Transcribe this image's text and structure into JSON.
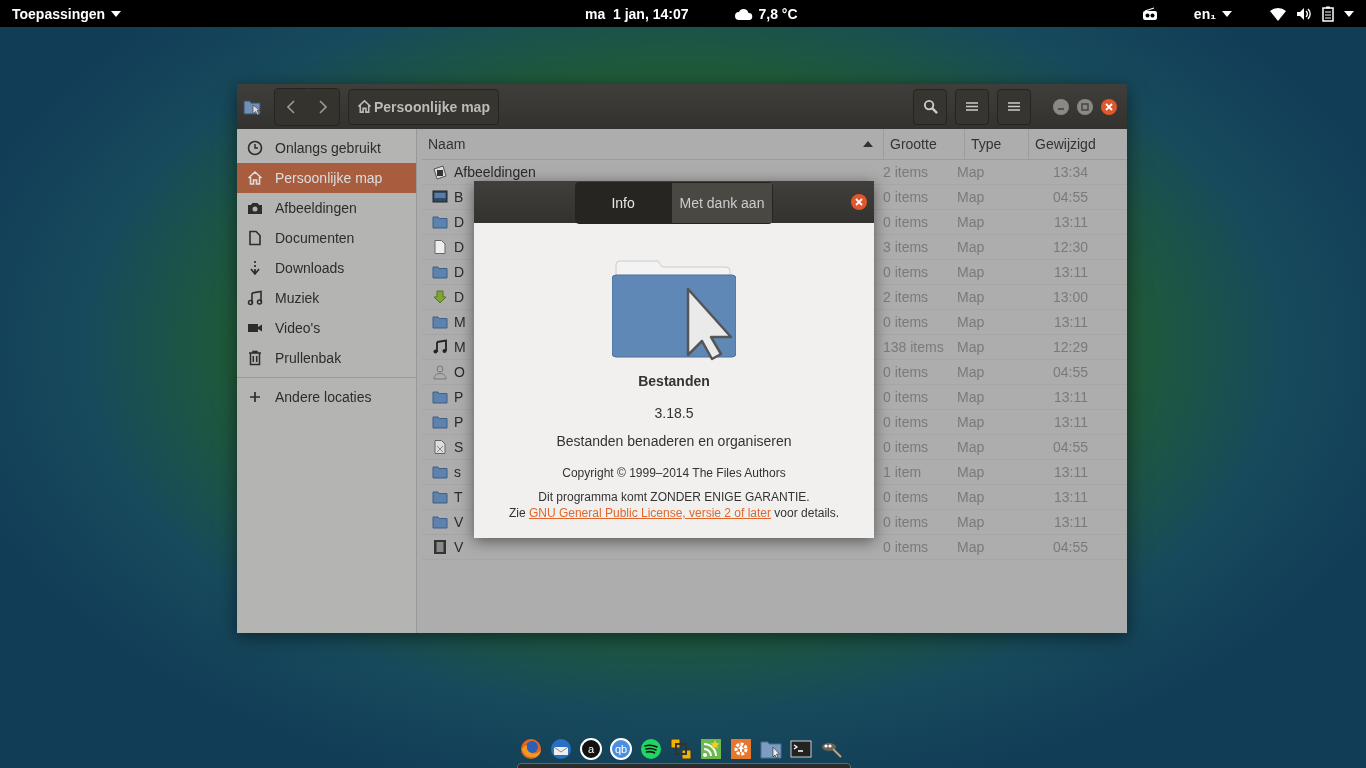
{
  "top_bar": {
    "apps_menu": "Toepassingen",
    "clock": "ma  1 jan, 14:07",
    "weather": "7,8 °C",
    "keyboard_layout": "en₁"
  },
  "window": {
    "path_button": "Persoonlijke map"
  },
  "sidebar": {
    "items": [
      {
        "kind": "clock",
        "label": "Onlangs gebruikt",
        "selected": false
      },
      {
        "kind": "home",
        "label": "Persoonlijke map",
        "selected": true
      },
      {
        "kind": "camera",
        "label": "Afbeeldingen",
        "selected": false
      },
      {
        "kind": "document",
        "label": "Documenten",
        "selected": false
      },
      {
        "kind": "download",
        "label": "Downloads",
        "selected": false
      },
      {
        "kind": "music",
        "label": "Muziek",
        "selected": false
      },
      {
        "kind": "video",
        "label": "Video's",
        "selected": false
      },
      {
        "kind": "trash",
        "label": "Prullenbak",
        "selected": false
      }
    ],
    "other_locations": "Andere locaties"
  },
  "table": {
    "columns": [
      {
        "label": "Naam",
        "sorted": true
      },
      {
        "label": "Grootte",
        "sorted": false
      },
      {
        "label": "Type",
        "sorted": false
      },
      {
        "label": "Gewijzigd",
        "sorted": false
      }
    ],
    "rows": [
      {
        "kind": "pictures",
        "name": "Afbeeldingen",
        "size": "2 items",
        "type": "Map",
        "modified": "13:34"
      },
      {
        "kind": "desktop",
        "name": "B",
        "size": "0 items",
        "type": "Map",
        "modified": "04:55"
      },
      {
        "kind": "folder",
        "name": "D",
        "size": "0 items",
        "type": "Map",
        "modified": "13:11"
      },
      {
        "kind": "document",
        "name": "D",
        "size": "3 items",
        "type": "Map",
        "modified": "12:30"
      },
      {
        "kind": "folder",
        "name": "D",
        "size": "0 items",
        "type": "Map",
        "modified": "13:11"
      },
      {
        "kind": "download",
        "name": "D",
        "size": "2 items",
        "type": "Map",
        "modified": "13:00"
      },
      {
        "kind": "folder",
        "name": "M",
        "size": "0 items",
        "type": "Map",
        "modified": "13:11"
      },
      {
        "kind": "music",
        "name": "M",
        "size": "138 items",
        "type": "Map",
        "modified": "12:29"
      },
      {
        "kind": "user",
        "name": "O",
        "size": "0 items",
        "type": "Map",
        "modified": "04:55"
      },
      {
        "kind": "folder",
        "name": "P",
        "size": "0 items",
        "type": "Map",
        "modified": "13:11"
      },
      {
        "kind": "folder",
        "name": "P",
        "size": "0 items",
        "type": "Map",
        "modified": "13:11"
      },
      {
        "kind": "template",
        "name": "S",
        "size": "0 items",
        "type": "Map",
        "modified": "04:55"
      },
      {
        "kind": "folder",
        "name": "s",
        "size": "1 item",
        "type": "Map",
        "modified": "13:11"
      },
      {
        "kind": "folder",
        "name": "T",
        "size": "0 items",
        "type": "Map",
        "modified": "13:11"
      },
      {
        "kind": "folder",
        "name": "V",
        "size": "0 items",
        "type": "Map",
        "modified": "13:11"
      },
      {
        "kind": "video",
        "name": "V",
        "size": "0 items",
        "type": "Map",
        "modified": "04:55"
      }
    ]
  },
  "about_dialog": {
    "tabs": [
      {
        "label": "Info",
        "selected": true
      },
      {
        "label": "Met dank aan",
        "selected": false
      }
    ],
    "app_name": "Bestanden",
    "version": "3.18.5",
    "description": "Bestanden benaderen en organiseren",
    "copyright": "Copyright © 1999–2014 The Files Authors",
    "warranty": "Dit programma komt ZONDER ENIGE GARANTIE.",
    "license_prefix": "Zie",
    "license_link": "GNU General Public License, versie 2 of later",
    "license_suffix": "voor details."
  },
  "dock": [
    {
      "kind": "globe"
    },
    {
      "kind": "mail"
    },
    {
      "kind": "letter",
      "label": "a"
    },
    {
      "kind": "letter",
      "label": "qb"
    },
    {
      "kind": "waves"
    },
    {
      "kind": "squares"
    },
    {
      "kind": "feed"
    },
    {
      "kind": "gear"
    },
    {
      "kind": "folder"
    },
    {
      "kind": "terminal"
    },
    {
      "kind": "brush"
    }
  ]
}
